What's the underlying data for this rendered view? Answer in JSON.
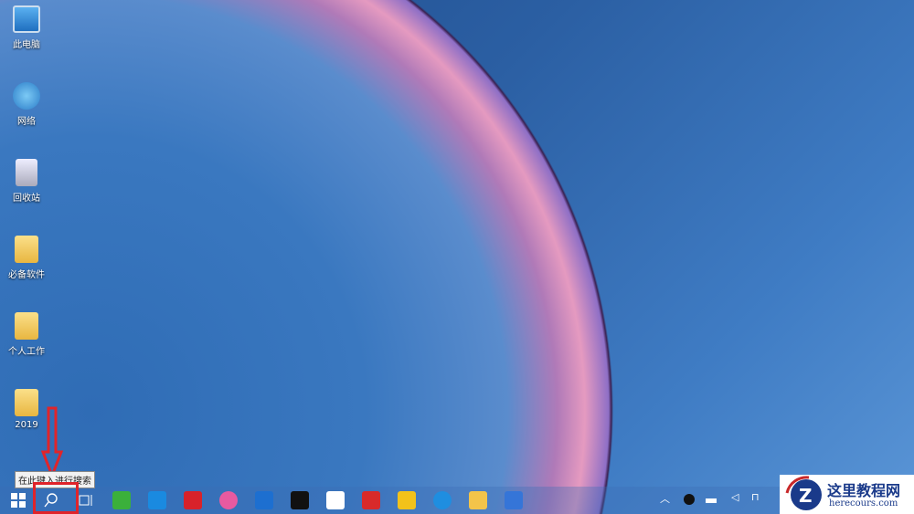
{
  "desktop_icons": [
    {
      "label": "此电脑",
      "icon": "computer-icon"
    },
    {
      "label": "网络",
      "icon": "network-icon"
    },
    {
      "label": "回收站",
      "icon": "recycle-bin-icon"
    },
    {
      "label": "必备软件",
      "icon": "folder-icon"
    },
    {
      "label": "个人工作",
      "icon": "folder-shortcut-icon"
    },
    {
      "label": "2019",
      "icon": "folder-icon"
    }
  ],
  "search_tooltip": "在此键入进行搜索",
  "taskbar_apps": [
    {
      "name": "wechat",
      "color": "#3bb03b"
    },
    {
      "name": "app-blue",
      "color": "#1a8ae0"
    },
    {
      "name": "it-app",
      "color": "#d8222a"
    },
    {
      "name": "color-wheel",
      "color": "#e85aa0"
    },
    {
      "name": "app-tools",
      "color": "#1d6fd0"
    },
    {
      "name": "qq",
      "color": "#111111"
    },
    {
      "name": "fox-app",
      "color": "#ffffff"
    },
    {
      "name": "red-app",
      "color": "#d82a2a"
    },
    {
      "name": "yellow-app",
      "color": "#f2c21a"
    },
    {
      "name": "edge",
      "color": "#1f8ee0"
    },
    {
      "name": "file-explorer",
      "color": "#f3c44a"
    },
    {
      "name": "wps",
      "color": "#3575d8"
    }
  ],
  "watermark": {
    "title": "这里教程网",
    "url": "herecours.com"
  }
}
